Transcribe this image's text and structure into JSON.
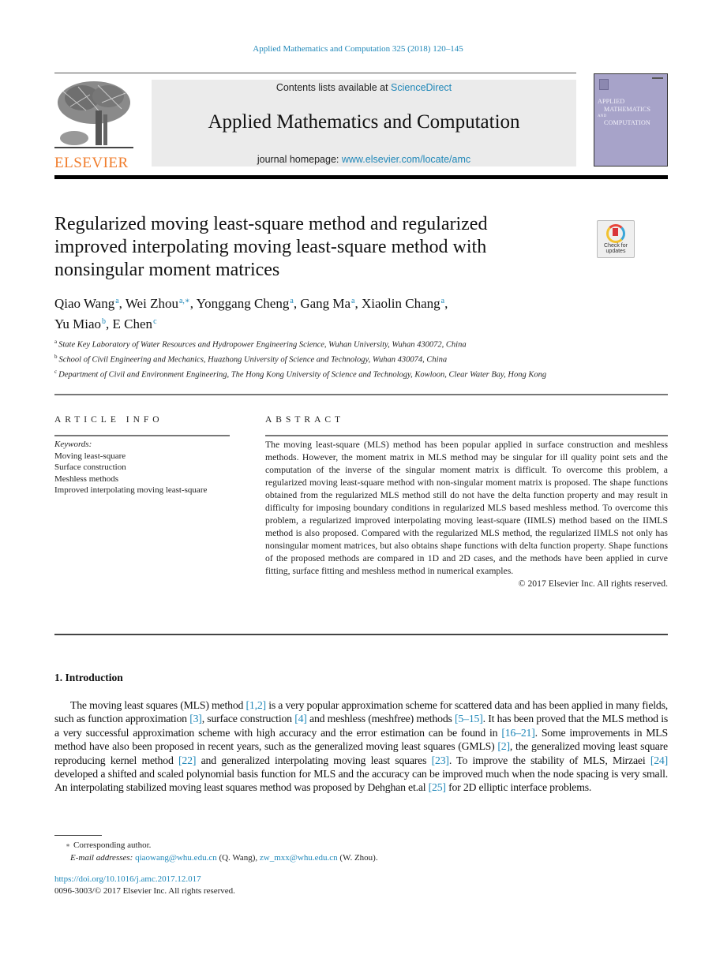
{
  "header": {
    "journal_ref": "Applied Mathematics and Computation 325 (2018) 120–145",
    "publisher_logo_text": "ELSEVIER",
    "contents_prefix": "Contents lists available at ",
    "contents_link": "ScienceDirect",
    "journal_name": "Applied Mathematics and Computation",
    "homepage_prefix": "journal homepage: ",
    "homepage_link": "www.elsevier.com/locate/amc",
    "cover_title_lines": [
      "APPLIED",
      "MATHEMATICS",
      "AND",
      "COMPUTATION"
    ],
    "crossmark_label_1": "Check for",
    "crossmark_label_2": "updates"
  },
  "article": {
    "title": "Regularized moving least-square method and regularized improved interpolating moving least-square method with nonsingular moment matrices",
    "authors": [
      {
        "name": "Qiao Wang",
        "sup": "a",
        "sep": ", "
      },
      {
        "name": "Wei Zhou",
        "sup": "a,∗",
        "sep": ", "
      },
      {
        "name": "Yonggang Cheng",
        "sup": "a",
        "sep": ", "
      },
      {
        "name": "Gang Ma",
        "sup": "a",
        "sep": ", "
      },
      {
        "name": "Xiaolin Chang",
        "sup": "a",
        "sep": ","
      },
      {
        "name": "Yu Miao",
        "sup": "b",
        "sep": ", "
      },
      {
        "name": "E Chen",
        "sup": "c",
        "sep": ""
      }
    ],
    "affiliations": [
      {
        "mark": "a",
        "text": "State Key Laboratory of Water Resources and Hydropower Engineering Science, Wuhan University, Wuhan 430072, China"
      },
      {
        "mark": "b",
        "text": "School of Civil Engineering and Mechanics, Huazhong University of Science and Technology, Wuhan 430074, China"
      },
      {
        "mark": "c",
        "text": "Department of Civil and Environment Engineering, The Hong Kong University of Science and Technology, Kowloon, Clear Water Bay, Hong Kong"
      }
    ]
  },
  "article_info": {
    "heading": "ARTICLE INFO",
    "keywords_label": "Keywords:",
    "keywords": [
      "Moving least-square",
      "Surface construction",
      "Meshless methods",
      "Improved interpolating moving least-square"
    ]
  },
  "abstract": {
    "heading": "ABSTRACT",
    "text": "The moving least-square (MLS) method has been popular applied in surface construction and meshless methods. However, the moment matrix in MLS method may be singular for ill quality point sets and the computation of the inverse of the singular moment matrix is difficult. To overcome this problem, a regularized moving least-square method with non-singular moment matrix is proposed. The shape functions obtained from the regularized MLS method still do not have the delta function property and may result in difficulty for imposing boundary conditions in regularized MLS based meshless method. To overcome this problem, a regularized improved interpolating moving least-square (IIMLS) method based on the IIMLS method is also proposed. Compared with the regularized MLS method, the regularized IIMLS not only has nonsingular moment matrices, but also obtains shape functions with delta function property. Shape functions of the proposed methods are compared in 1D and 2D cases, and the methods have been applied in curve fitting, surface fitting and meshless method in numerical examples.",
    "copyright": "© 2017 Elsevier Inc. All rights reserved."
  },
  "introduction": {
    "heading": "1. Introduction",
    "segments": [
      {
        "t": "The moving least squares (MLS) method "
      },
      {
        "t": "[1,2]",
        "ref": true
      },
      {
        "t": " is a very popular approximation scheme for scattered data and has been applied in many fields, such as function approximation "
      },
      {
        "t": "[3]",
        "ref": true
      },
      {
        "t": ", surface construction "
      },
      {
        "t": "[4]",
        "ref": true
      },
      {
        "t": " and meshless (meshfree) methods "
      },
      {
        "t": "[5–15]",
        "ref": true
      },
      {
        "t": ". It has been proved that the MLS method is a very successful approximation scheme with high accuracy and the error estimation can be found in "
      },
      {
        "t": "[16–21]",
        "ref": true
      },
      {
        "t": ". Some improvements in MLS method have also been proposed in recent years, such as the generalized moving least squares (GMLS) "
      },
      {
        "t": "[2]",
        "ref": true
      },
      {
        "t": ", the generalized moving least square reproducing kernel method "
      },
      {
        "t": "[22]",
        "ref": true
      },
      {
        "t": " and generalized interpolating moving least squares "
      },
      {
        "t": "[23]",
        "ref": true
      },
      {
        "t": ". To improve the stability of MLS, Mirzaei "
      },
      {
        "t": "[24]",
        "ref": true
      },
      {
        "t": " developed a shifted and scaled polynomial basis function for MLS and the accuracy can be improved much when the node spacing is very small. An interpolating stabilized moving least squares method was proposed by Dehghan et.al "
      },
      {
        "t": "[25]",
        "ref": true
      },
      {
        "t": " for 2D elliptic interface problems."
      }
    ]
  },
  "footnotes": {
    "star": "∗",
    "corresponding": "Corresponding author.",
    "email_label": "E-mail addresses:",
    "email_1": "qiaowang@whu.edu.cn",
    "email_1_owner": " (Q. Wang), ",
    "email_2": "zw_mxx@whu.edu.cn",
    "email_2_owner": " (W. Zhou).",
    "doi": "https://doi.org/10.1016/j.amc.2017.12.017",
    "issn": "0096-3003/© 2017 Elsevier Inc. All rights reserved."
  },
  "colors": {
    "link": "#1f87b8",
    "elsevier_orange": "#f07c2b",
    "cover": "#a7a3c9",
    "banner": "#ebebeb"
  }
}
